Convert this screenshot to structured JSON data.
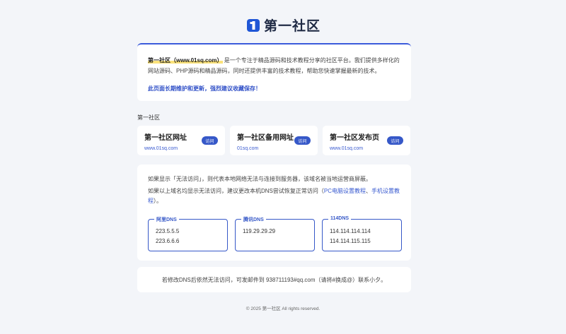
{
  "logo": {
    "text": "第一社区"
  },
  "intro": {
    "site_name": "第一社区（www.01sq.com）",
    "description": "是一个专注于精品源码和技术教程分享的社区平台。我们提供多样化的网站源码、PHP源码和精品源码，同时还提供丰富的技术教程，帮助您快速掌握最新的技术。",
    "notice": "此页面长期维护和更新，强烈建议收藏保存！"
  },
  "section_title": "第一社区",
  "sites": [
    {
      "name": "第一社区网址",
      "url": "www.01sq.com",
      "button": "访问"
    },
    {
      "name": "第一社区备用网址",
      "url": "01sq.com",
      "button": "访问"
    },
    {
      "name": "第一社区发布页",
      "url": "www.01sq.com",
      "button": "访问"
    }
  ],
  "dns": {
    "line1": "如果显示「无法访问」，则代表本地网络无法与连接到服务器，该域名被当地运营商屏蔽。",
    "line2_prefix": "如果以上域名均显示无法访问，建议更改本机DNS尝试恢复正常访问（",
    "link_pc": "PC电脑设置教程",
    "sep": "、",
    "link_mobile": "手机设置教程",
    "line2_suffix": "）。",
    "servers": [
      {
        "label": "阿里DNS",
        "ips": [
          "223.5.5.5",
          "223.6.6.6"
        ]
      },
      {
        "label": "腾讯DNS",
        "ips": [
          "119.29.29.29"
        ]
      },
      {
        "label": "114DNS",
        "ips": [
          "114.114.114.114",
          "114.114.115.115"
        ]
      }
    ]
  },
  "contact": {
    "text": "若修改DNS后依然无法访问，可发邮件到 938711193#qq.com（请将#换成@）联系小夕。"
  },
  "footer": {
    "text": "© 2025 第一社区 All rights reserved."
  },
  "colors": {
    "accent": "#3658c8",
    "background": "#f3f5f9",
    "highlight": "#fbe27a"
  }
}
